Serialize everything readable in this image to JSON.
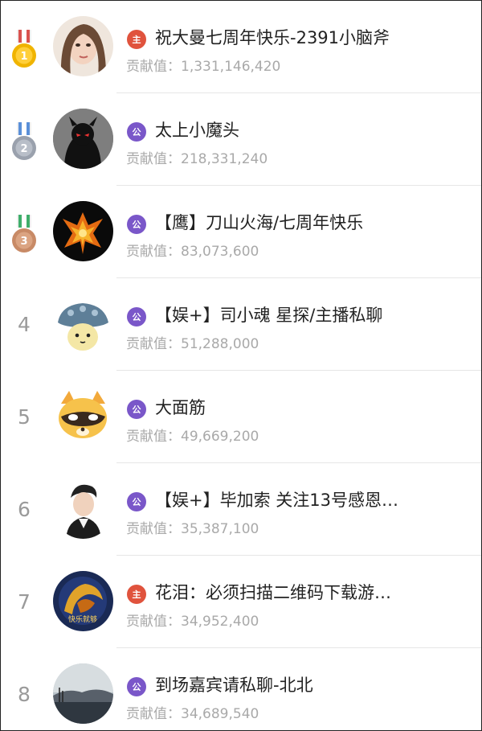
{
  "score_label": "贡献值：",
  "rows": [
    {
      "rank": "1",
      "badge": "主",
      "badge_color": "#e0533d",
      "name": "祝大曼七周年快乐-2391小脑斧",
      "score": "1,331,146,420"
    },
    {
      "rank": "2",
      "badge": "公",
      "badge_color": "#7a57c9",
      "name": "太上小魔头",
      "score": "218,331,240"
    },
    {
      "rank": "3",
      "badge": "公",
      "badge_color": "#7a57c9",
      "name": "【鹰】刀山火海/七周年快乐",
      "score": "83,073,600"
    },
    {
      "rank": "4",
      "badge": "公",
      "badge_color": "#7a57c9",
      "name": "【娱+】司小魂 星探/主播私聊",
      "score": "51,288,000"
    },
    {
      "rank": "5",
      "badge": "公",
      "badge_color": "#7a57c9",
      "name": "大面筋",
      "score": "49,669,200"
    },
    {
      "rank": "6",
      "badge": "公",
      "badge_color": "#7a57c9",
      "name": "【娱+】毕加索 关注13号感恩…",
      "score": "35,387,100"
    },
    {
      "rank": "7",
      "badge": "主",
      "badge_color": "#e0533d",
      "name": "花泪：必须扫描二维码下载游…",
      "score": "34,952,400"
    },
    {
      "rank": "8",
      "badge": "公",
      "badge_color": "#7a57c9",
      "name": "到场嘉宾请私聊-北北",
      "score": "34,689,540"
    }
  ],
  "medal_colors": {
    "gold": "#f0b400",
    "silver": "#9aa1ad",
    "bronze": "#c88a66"
  },
  "avatar_7_text": "快乐就够"
}
